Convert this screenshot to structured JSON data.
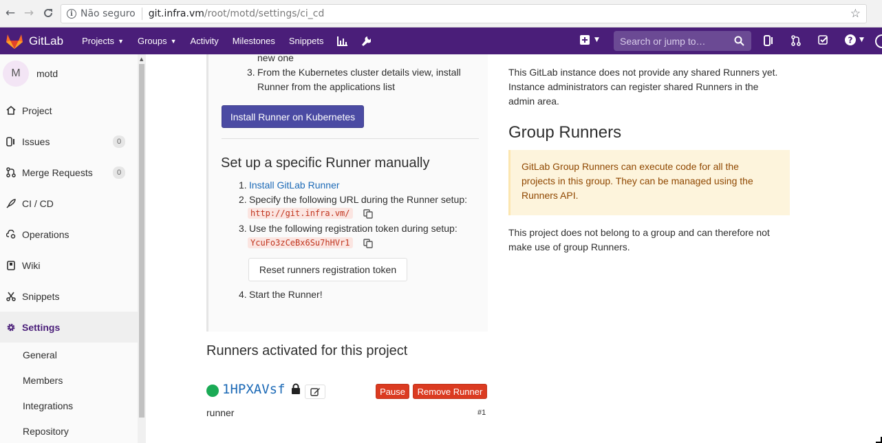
{
  "browser": {
    "insecure_label": "Não seguro",
    "url_host": "git.infra.vm",
    "url_path": "/root/motd/settings/ci_cd"
  },
  "header": {
    "brand": "GitLab",
    "menu": {
      "projects": "Projects",
      "groups": "Groups",
      "activity": "Activity",
      "milestones": "Milestones",
      "snippets": "Snippets"
    },
    "search_placeholder": "Search or jump to…",
    "colors": {
      "background": "#4a1e79",
      "search_bg": "#6b4a94"
    }
  },
  "sidebar": {
    "avatar_letter": "M",
    "project_name": "motd",
    "items": {
      "project": "Project",
      "issues": "Issues",
      "issues_count": "0",
      "merge_requests": "Merge Requests",
      "merge_requests_count": "0",
      "cicd": "CI / CD",
      "operations": "Operations",
      "wiki": "Wiki",
      "snippets": "Snippets",
      "settings": "Settings"
    },
    "settings_sub": {
      "general": "General",
      "members": "Members",
      "integrations": "Integrations",
      "repository": "Repository"
    }
  },
  "kubernetes": {
    "step2_tail": "new one",
    "step3_num": "3.",
    "step3_line1": "From the Kubernetes cluster details view, install",
    "step3_line2": "Runner from the applications list",
    "install_button": "Install Runner on Kubernetes"
  },
  "specific": {
    "title": "Set up a specific Runner manually",
    "steps": {
      "n1": "1.",
      "s1_link": "Install GitLab Runner",
      "n2": "2.",
      "s2": "Specify the following URL during the Runner setup:",
      "url": "http://git.infra.vm/",
      "n3": "3.",
      "s3": "Use the following registration token during setup:",
      "token": "YcuFo3zCeBx6Su7hHVr1",
      "reset_button": "Reset runners registration token",
      "n4": "4.",
      "s4": "Start the Runner!"
    }
  },
  "activated": {
    "title": "Runners activated for this project",
    "runner": {
      "id": "1HPXAVsf",
      "pause_button": "Pause",
      "remove_button": "Remove Runner",
      "description": "runner",
      "number": "#1",
      "status_color": "#1aaa55"
    }
  },
  "shared": {
    "line1": "This GitLab instance does not provide any shared Runners yet.",
    "line2": "Instance administrators can register shared Runners in the",
    "line3": "admin area."
  },
  "group": {
    "title": "Group Runners",
    "info_line1": "GitLab Group Runners can execute code for all the",
    "info_line2": "projects in this group. They can be managed using the",
    "info_line3": "Runners API.",
    "note_line1": "This project does not belong to a group and can therefore not",
    "note_line2": "make use of group Runners."
  }
}
